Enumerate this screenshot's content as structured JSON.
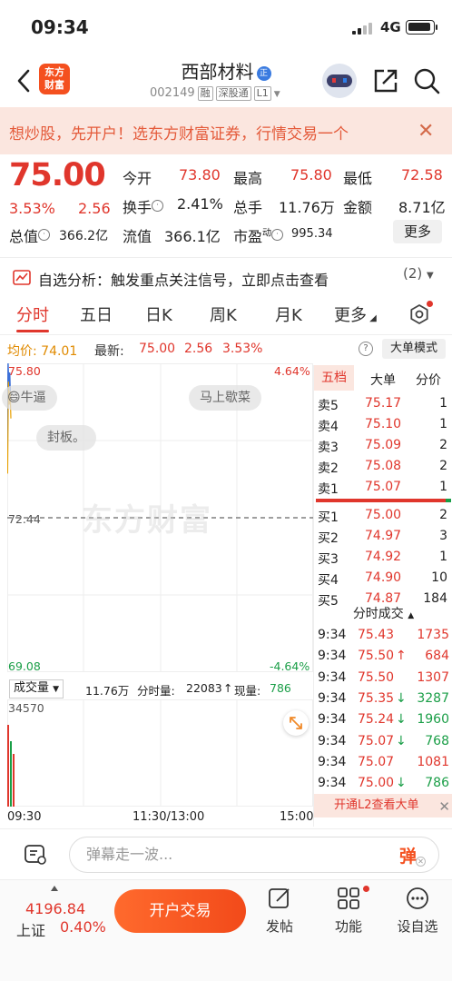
{
  "status": {
    "time": "09:34",
    "network": "4G"
  },
  "header": {
    "logo_text": [
      "东方",
      "财富"
    ],
    "title": "西部材料",
    "badge": "正",
    "code": "002149",
    "tags": [
      "融",
      "深股通",
      "L1"
    ]
  },
  "banner": {
    "text": "想炒股，先开户！选东方财富证券，行情交易一个"
  },
  "quote": {
    "price": "75.00",
    "change_pct": "3.53%",
    "change": "2.56",
    "fields": {
      "open_label": "今开",
      "open": "73.80",
      "high_label": "最高",
      "high": "75.80",
      "low_label": "最低",
      "low": "72.58",
      "turnover_label": "换手",
      "turnover": "2.41%",
      "volume_label": "总手",
      "volume": "11.76万",
      "amount_label": "金额",
      "amount": "8.71亿",
      "mcap_label": "总值",
      "mcap": "366.2亿",
      "float_label": "流值",
      "float": "366.1亿",
      "pe_label": "市盈",
      "pe_sup": "动",
      "pe": "995.34"
    },
    "more_label": "更多"
  },
  "analysis": {
    "text": "自选分析：触发重点关注信号，立即点击查看",
    "count": "(2)"
  },
  "tabs": [
    "分时",
    "五日",
    "日K",
    "周K",
    "月K",
    "更多"
  ],
  "avg_line": {
    "avg_label": "均价:",
    "avg": "74.01",
    "latest_label": "最新:",
    "latest": "75.00",
    "change": "2.56",
    "pct": "3.53%",
    "big_order": "大单模式"
  },
  "chart": {
    "y_top": "75.80",
    "y_mid": "72.44",
    "y_bot": "69.08",
    "pct_top": "4.64%",
    "pct_bot": "-4.64%",
    "bubbles": [
      "牛逼",
      "马上歇菜",
      "封板。"
    ],
    "watermark": "东方财富"
  },
  "chart_data": {
    "type": "line",
    "title": "",
    "ylim": [
      69.08,
      75.8
    ],
    "series": [
      {
        "values": [
          73.8,
          75.8,
          75.3,
          75.6,
          75.0
        ]
      }
    ],
    "volume_max": "34570"
  },
  "volume": {
    "selector": "成交量",
    "total": "11.76万",
    "fenshi_label": "分时量:",
    "fenshi": "22083",
    "xianliang_label": "现量:",
    "xianliang": "786"
  },
  "time_axis": [
    "09:30",
    "11:30/13:00",
    "15:00"
  ],
  "book": {
    "tabs": [
      "五档",
      "大单",
      "分价"
    ],
    "asks": [
      {
        "label": "卖5",
        "price": "75.17",
        "vol": "1"
      },
      {
        "label": "卖4",
        "price": "75.10",
        "vol": "1"
      },
      {
        "label": "卖3",
        "price": "75.09",
        "vol": "2"
      },
      {
        "label": "卖2",
        "price": "75.08",
        "vol": "2"
      },
      {
        "label": "卖1",
        "price": "75.07",
        "vol": "1"
      }
    ],
    "bids": [
      {
        "label": "买1",
        "price": "75.00",
        "vol": "2"
      },
      {
        "label": "买2",
        "price": "74.97",
        "vol": "3"
      },
      {
        "label": "买3",
        "price": "74.92",
        "vol": "1"
      },
      {
        "label": "买4",
        "price": "74.90",
        "vol": "10"
      },
      {
        "label": "买5",
        "price": "74.87",
        "vol": "184"
      }
    ],
    "ticks_title": "分时成交",
    "ticks": [
      {
        "time": "9:34",
        "price": "75.43",
        "vol": "1735",
        "dir": ""
      },
      {
        "time": "9:34",
        "price": "75.50",
        "vol": "684",
        "dir": "↑"
      },
      {
        "time": "9:34",
        "price": "75.50",
        "vol": "1307",
        "dir": ""
      },
      {
        "time": "9:34",
        "price": "75.35",
        "vol": "3287",
        "dir": "↓"
      },
      {
        "time": "9:34",
        "price": "75.24",
        "vol": "1960",
        "dir": "↓"
      },
      {
        "time": "9:34",
        "price": "75.07",
        "vol": "768",
        "dir": "↓"
      },
      {
        "time": "9:34",
        "price": "75.07",
        "vol": "1081",
        "dir": ""
      },
      {
        "time": "9:34",
        "price": "75.00",
        "vol": "786",
        "dir": "↓"
      }
    ],
    "l2_text": "开通L2查看大单"
  },
  "comment": {
    "placeholder": "弹幕走一波...",
    "danmu": "弹"
  },
  "nav": {
    "index_value": "4196.84",
    "index_name": "上证",
    "index_pct": "0.40%",
    "trade": "开户交易",
    "items": [
      "发帖",
      "功能",
      "设自选"
    ]
  }
}
